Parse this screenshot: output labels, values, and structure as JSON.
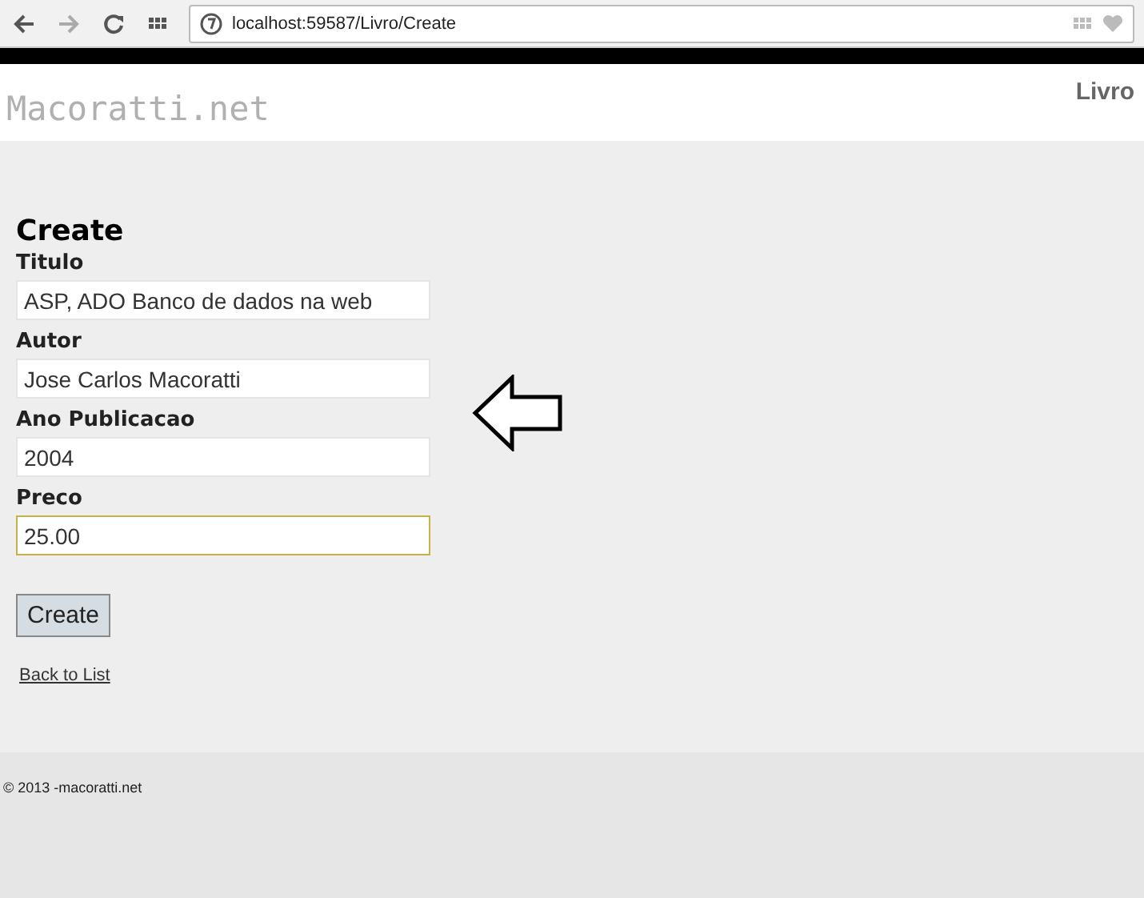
{
  "browser": {
    "address": "localhost:59587/Livro/Create"
  },
  "header": {
    "logo": "Macoratti.net",
    "nav": "Livro"
  },
  "page": {
    "title": "Create",
    "fields": [
      {
        "label": "Titulo",
        "value": "ASP, ADO Banco de dados na web",
        "focused": false
      },
      {
        "label": "Autor",
        "value": "Jose Carlos Macoratti",
        "focused": false
      },
      {
        "label": "Ano Publicacao",
        "value": "2004",
        "focused": false
      },
      {
        "label": "Preco",
        "value": "25.00",
        "focused": true
      }
    ],
    "submit": "Create",
    "back_link": "Back to List"
  },
  "footer": {
    "text": "© 2013 -macoratti.net"
  }
}
